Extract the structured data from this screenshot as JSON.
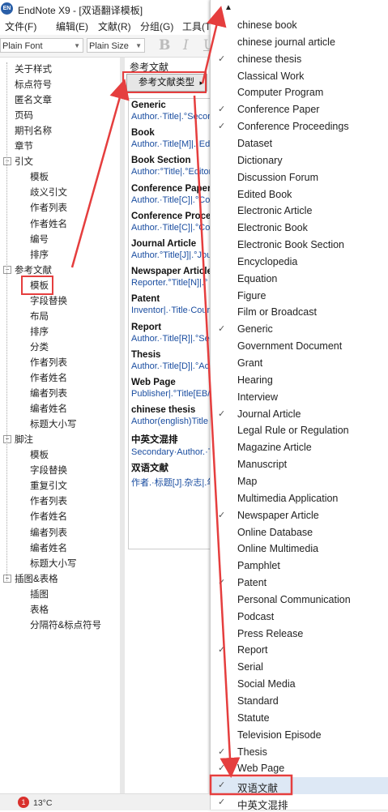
{
  "window": {
    "app_icon": "EN",
    "title": "EndNote X9 - [双语翻译模板]"
  },
  "menubar": [
    "文件(F)",
    "编辑(E)",
    "文献(R)",
    "分组(G)",
    "工具(T"
  ],
  "toolbar": {
    "font": "Plain Font",
    "size": "Plain Size",
    "bold": "B",
    "italic": "I",
    "underline": "U"
  },
  "tree": {
    "items": [
      {
        "label": "关于样式",
        "level": 0
      },
      {
        "label": "标点符号",
        "level": 0
      },
      {
        "label": "匿名文章",
        "level": 0
      },
      {
        "label": "页码",
        "level": 0
      },
      {
        "label": "期刊名称",
        "level": 0
      },
      {
        "label": "章节",
        "level": 0
      },
      {
        "label": "引文",
        "level": 0,
        "expander": "−"
      },
      {
        "label": "模板",
        "level": 1
      },
      {
        "label": "歧义引文",
        "level": 1
      },
      {
        "label": "作者列表",
        "level": 1
      },
      {
        "label": "作者姓名",
        "level": 1
      },
      {
        "label": "编号",
        "level": 1
      },
      {
        "label": "排序",
        "level": 1
      },
      {
        "label": "参考文献",
        "level": 0,
        "expander": "−"
      },
      {
        "label": "模板",
        "level": 1,
        "highlight": true
      },
      {
        "label": "字段替换",
        "level": 1
      },
      {
        "label": "布局",
        "level": 1
      },
      {
        "label": "排序",
        "level": 1
      },
      {
        "label": "分类",
        "level": 1
      },
      {
        "label": "作者列表",
        "level": 1
      },
      {
        "label": "作者姓名",
        "level": 1
      },
      {
        "label": "编者列表",
        "level": 1
      },
      {
        "label": "编者姓名",
        "level": 1
      },
      {
        "label": "标题大小写",
        "level": 1
      },
      {
        "label": "脚注",
        "level": 0,
        "expander": "−"
      },
      {
        "label": "模板",
        "level": 1
      },
      {
        "label": "字段替换",
        "level": 1
      },
      {
        "label": "重复引文",
        "level": 1
      },
      {
        "label": "作者列表",
        "level": 1
      },
      {
        "label": "作者姓名",
        "level": 1
      },
      {
        "label": "编者列表",
        "level": 1
      },
      {
        "label": "编者姓名",
        "level": 1
      },
      {
        "label": "标题大小写",
        "level": 1
      },
      {
        "label": "插图&表格",
        "level": 0,
        "expander": "−"
      },
      {
        "label": "插图",
        "level": 1
      },
      {
        "label": "表格",
        "level": 1
      },
      {
        "label": "分隔符&标点符号",
        "level": 1
      }
    ]
  },
  "panel": {
    "header": "参考文献",
    "dropdown_label": "参考文献类型",
    "dropdown_caret": "▸",
    "formats": [
      {
        "name": "Generic",
        "sample": "Author.·Title|.°Secondary"
      },
      {
        "name": "Book",
        "sample": "Author.·Title[M]|.·Edition"
      },
      {
        "name": "Book Section",
        "sample": "Author:°Title|.°Editor"
      },
      {
        "name": "Conference Paper",
        "sample": "Author.·Title[C]|.°Co"
      },
      {
        "name": "Conference Proce",
        "sample": "Author.·Title[C]|.°Co"
      },
      {
        "name": "Journal Article",
        "sample": "Author.°Title[J]|.°Jou"
      },
      {
        "name": "Newspaper Article",
        "sample": "Reporter.°Title[N]|.°"
      },
      {
        "name": "Patent",
        "sample": "Inventor|.·Title·Country"
      },
      {
        "name": "Report",
        "sample": "Author.·Title[R]|.°Series"
      },
      {
        "name": "Thesis",
        "sample": "Author.·Title[D]|.°Aca"
      },
      {
        "name": "Web Page",
        "sample": "Publisher|.°Title[EB/OL"
      },
      {
        "name": "chinese thesis",
        "sample": "Author(english)Title"
      },
      {
        "name": "中英文混排",
        "sample": "Secondary·Author.·Tit"
      },
      {
        "name": "双语文献",
        "sample": "作者.·标题[J].杂志|.年"
      }
    ]
  },
  "popup": {
    "up_arrow": "▲",
    "items": [
      {
        "label": "chinese book",
        "checked": false
      },
      {
        "label": "chinese journal article",
        "checked": false
      },
      {
        "label": "chinese thesis",
        "checked": true
      },
      {
        "label": "Classical Work",
        "checked": false
      },
      {
        "label": "Computer Program",
        "checked": false
      },
      {
        "label": "Conference Paper",
        "checked": true
      },
      {
        "label": "Conference Proceedings",
        "checked": true
      },
      {
        "label": "Dataset",
        "checked": false
      },
      {
        "label": "Dictionary",
        "checked": false
      },
      {
        "label": "Discussion Forum",
        "checked": false
      },
      {
        "label": "Edited Book",
        "checked": false
      },
      {
        "label": "Electronic Article",
        "checked": false
      },
      {
        "label": "Electronic Book",
        "checked": false
      },
      {
        "label": "Electronic Book Section",
        "checked": false
      },
      {
        "label": "Encyclopedia",
        "checked": false
      },
      {
        "label": "Equation",
        "checked": false
      },
      {
        "label": "Figure",
        "checked": false
      },
      {
        "label": "Film or Broadcast",
        "checked": false
      },
      {
        "label": "Generic",
        "checked": true
      },
      {
        "label": "Government Document",
        "checked": false
      },
      {
        "label": "Grant",
        "checked": false
      },
      {
        "label": "Hearing",
        "checked": false
      },
      {
        "label": "Interview",
        "checked": false
      },
      {
        "label": "Journal Article",
        "checked": true
      },
      {
        "label": "Legal Rule or Regulation",
        "checked": false
      },
      {
        "label": "Magazine Article",
        "checked": false
      },
      {
        "label": "Manuscript",
        "checked": false
      },
      {
        "label": "Map",
        "checked": false
      },
      {
        "label": "Multimedia Application",
        "checked": false
      },
      {
        "label": "Newspaper Article",
        "checked": true
      },
      {
        "label": "Online Database",
        "checked": false
      },
      {
        "label": "Online Multimedia",
        "checked": false
      },
      {
        "label": "Pamphlet",
        "checked": false
      },
      {
        "label": "Patent",
        "checked": true
      },
      {
        "label": "Personal Communication",
        "checked": false
      },
      {
        "label": "Podcast",
        "checked": false
      },
      {
        "label": "Press Release",
        "checked": false
      },
      {
        "label": "Report",
        "checked": true
      },
      {
        "label": "Serial",
        "checked": false
      },
      {
        "label": "Social Media",
        "checked": false
      },
      {
        "label": "Standard",
        "checked": false
      },
      {
        "label": "Statute",
        "checked": false
      },
      {
        "label": "Television Episode",
        "checked": false
      },
      {
        "label": "Thesis",
        "checked": true
      },
      {
        "label": "Web Page",
        "checked": true
      },
      {
        "label": "双语文献",
        "checked": true,
        "selected": true
      },
      {
        "label": "中英文混排",
        "checked": true
      }
    ]
  },
  "statusbar": {
    "badge": "1",
    "temperature": "13°C"
  },
  "colors": {
    "annotation": "#e53e3e",
    "sample_text": "#1a4da0",
    "selected_bg": "#dde8f5"
  }
}
